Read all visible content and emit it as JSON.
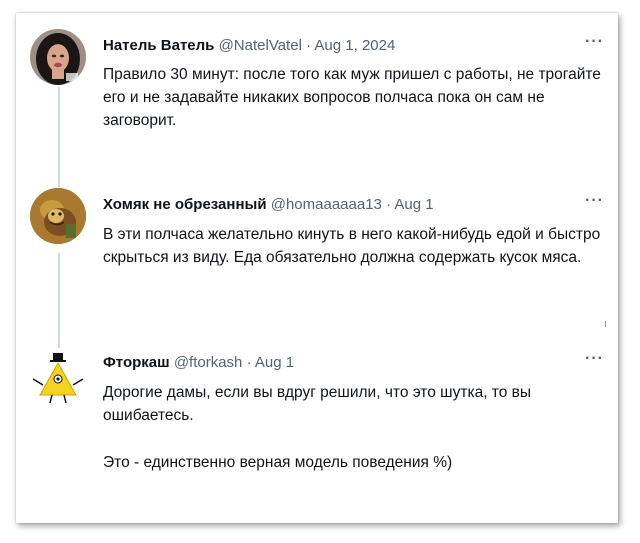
{
  "tweets": [
    {
      "name": "Натель Ватель",
      "handle": "@NatelVatel",
      "separator": "·",
      "date": "Aug 1, 2024",
      "more": "···",
      "text": [
        "Правило 30 минут: после того как муж пришел с работы, не трогайте его и не задавайте никаких вопросов полчаса пока он сам не заговорит."
      ],
      "avatar_icon": "person-avatar"
    },
    {
      "name": "Хомяк не обрезанный",
      "handle": "@homaaaaaa13",
      "separator": "·",
      "date": "Aug 1",
      "more": "···",
      "text": [
        "В эти полчаса желательно кинуть в него какой-нибудь едой и быстро скрыться из виду. Еда обязательно должна содержать кусок мяса."
      ],
      "avatar_icon": "cartoon-character-avatar"
    },
    {
      "name": "Фторкаш",
      "handle": "@ftorkash",
      "separator": "·",
      "date": "Aug 1",
      "more": "···",
      "text": [
        "Дорогие дамы, если вы вдруг решили, что это шутка, то вы ошибаетесь.",
        "Это - единственно верная модель поведения %)"
      ],
      "avatar_icon": "yellow-triangle-avatar"
    }
  ],
  "colors": {
    "text": "#0f1419",
    "meta": "#536471",
    "thread_line": "#cfd9de"
  }
}
